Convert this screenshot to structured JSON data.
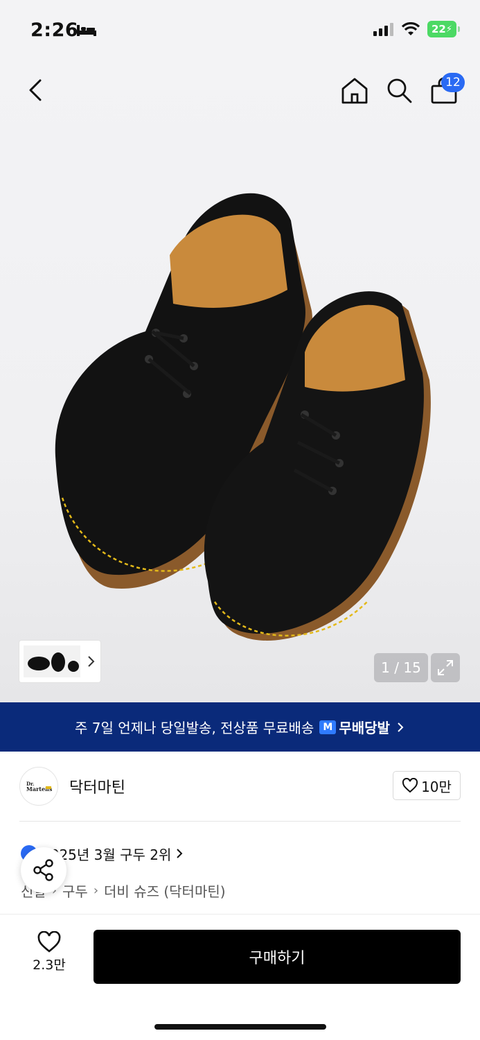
{
  "status_bar": {
    "time": "2:26",
    "battery": "22"
  },
  "header": {
    "cart_count": "12",
    "icons": [
      "back-icon",
      "home-icon",
      "search-icon",
      "cart-icon"
    ]
  },
  "gallery": {
    "counter": "1 / 15",
    "thumb_icon": "chevron-right-icon",
    "expand_icon": "expand-icon"
  },
  "shipping_banner": {
    "text": "주 7일 언제나 당일발송, 전상품 무료배송",
    "logo_mark": "M",
    "logo_text": "무배당발",
    "colors": {
      "background": "#0a2a7a",
      "logo": "#2f7bff"
    }
  },
  "brand": {
    "name": "닥터마틴",
    "like_count": "10만"
  },
  "ranking": {
    "text": "2025년 3월 구두 2위"
  },
  "breadcrumb": {
    "items": [
      "신발",
      "구두",
      "더비 슈즈 (닥터마틴)"
    ]
  },
  "bottom_bar": {
    "wish_count": "2.3만",
    "buy_label": "구매하기"
  },
  "colors": {
    "accent_blue": "#2a6af3",
    "buy_button": "#000000"
  }
}
